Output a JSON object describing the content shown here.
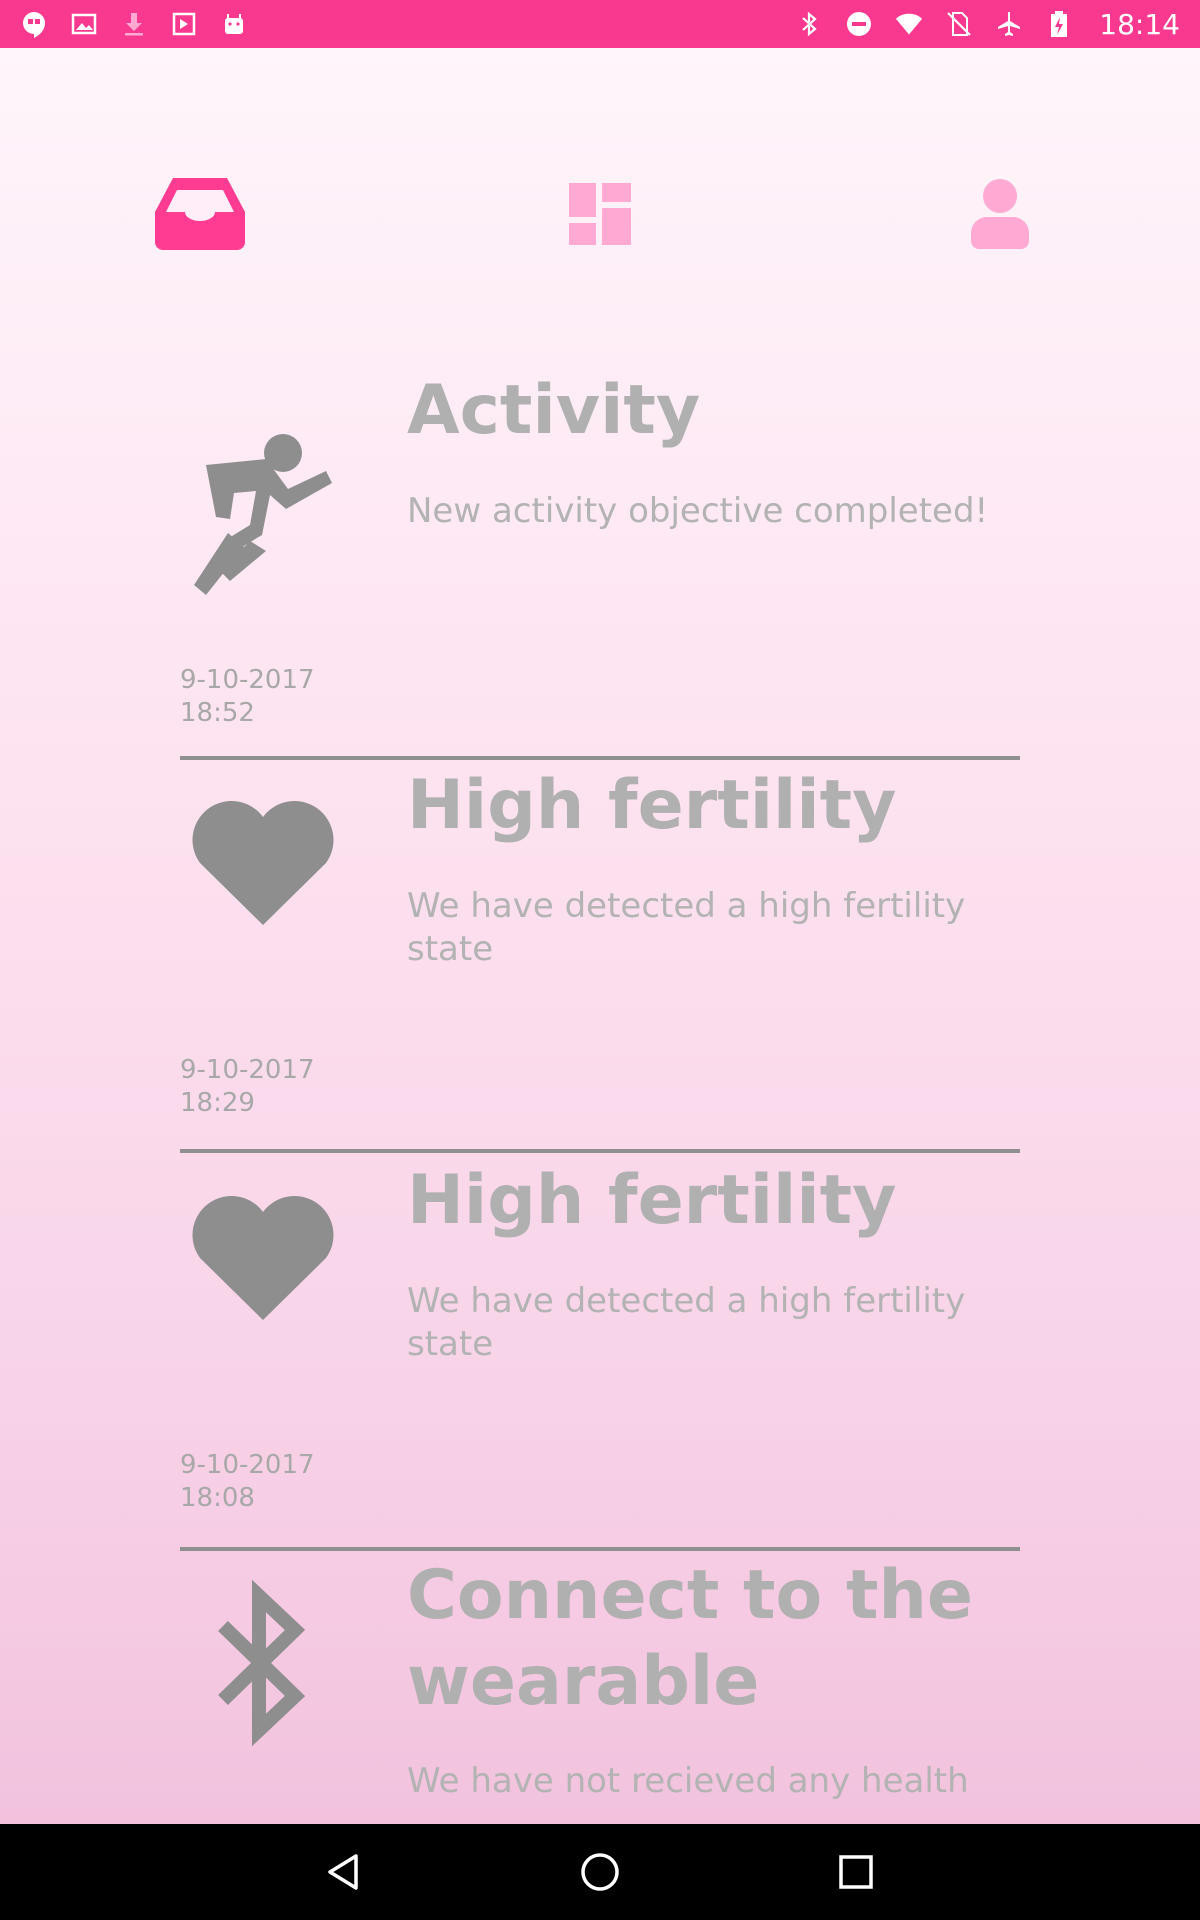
{
  "status_bar": {
    "time": "18:14",
    "left_icons": [
      "hangouts-icon",
      "image-icon",
      "download-icon",
      "play-store-icon",
      "android-icon"
    ],
    "right_icons": [
      "bluetooth-icon",
      "do-not-disturb-icon",
      "wifi-icon",
      "no-sim-icon",
      "airplane-mode-icon",
      "battery-charging-icon"
    ],
    "background": "#f8398f"
  },
  "tabs": [
    {
      "icon": "inbox-icon",
      "active": true
    },
    {
      "icon": "dashboard-icon",
      "active": false
    },
    {
      "icon": "profile-icon",
      "active": false
    }
  ],
  "colors": {
    "accent": "#f8398f",
    "tab_active": "#ff3c91",
    "tab_inactive": "#ffa9d3",
    "text_muted": "#b0b0b0",
    "icon_gray": "#8e8e8e"
  },
  "notifications": [
    {
      "icon": "running-person-icon",
      "title": "Activity",
      "message": "New activity objective completed!",
      "date": "9-10-2017",
      "time": "18:52"
    },
    {
      "icon": "heart-icon",
      "title": "High fertility",
      "message": "We have detected a high fertility state",
      "date": "9-10-2017",
      "time": "18:29"
    },
    {
      "icon": "heart-icon",
      "title": "High fertility",
      "message": "We have detected a high fertility state",
      "date": "9-10-2017",
      "time": "18:08"
    },
    {
      "icon": "bluetooth-icon",
      "title": "Connect to the wearable",
      "message": "We have not recieved any health",
      "date": "",
      "time": ""
    }
  ],
  "nav_bar": {
    "buttons": [
      "back-icon",
      "home-icon",
      "recents-icon"
    ]
  }
}
